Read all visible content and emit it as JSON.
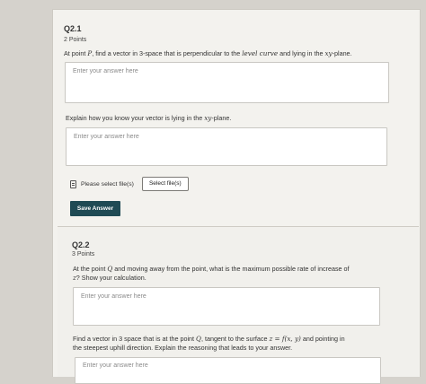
{
  "q1": {
    "number": "Q2.1",
    "points": "2 Points",
    "prompt_a_pre": "At point ",
    "prompt_a_point": "P",
    "prompt_a_mid": ", find a vector in 3-space that is perpendicular to the ",
    "prompt_a_em": "level curve",
    "prompt_a_and": " and lying in the ",
    "prompt_a_plane": "xy",
    "prompt_a_post": "-plane.",
    "answer_a_placeholder": "Enter your answer here",
    "prompt_b_pre": "Explain how you know your vector is lying in the ",
    "prompt_b_plane": "xy",
    "prompt_b_post": "-plane.",
    "answer_b_placeholder": "Enter your answer here",
    "upload_label": "Please select file(s)",
    "select_button": "Select file(s)",
    "save_button": "Save Answer"
  },
  "q2": {
    "number": "Q2.2",
    "points": "3 Points",
    "prompt_a_line1_pre": "At the point ",
    "prompt_a_line1_point": "Q",
    "prompt_a_line1_post": " and moving away from the point, what is the maximum possible rate of increase of",
    "prompt_a_line2_var": "z",
    "prompt_a_line2_post": "? Show your calculation.",
    "answer_a_placeholder": "Enter your answer here",
    "prompt_b_line1_pre": "Find a vector in 3 space that is at the point ",
    "prompt_b_line1_point": "Q",
    "prompt_b_line1_mid": ", tangent to the surface ",
    "prompt_b_line1_eq": "z = f(x, y)",
    "prompt_b_line1_post": " and pointing in",
    "prompt_b_line2": "the steepest uphill direction. Explain the reasoning that leads to your answer.",
    "answer_b_placeholder": "Enter your answer here"
  }
}
